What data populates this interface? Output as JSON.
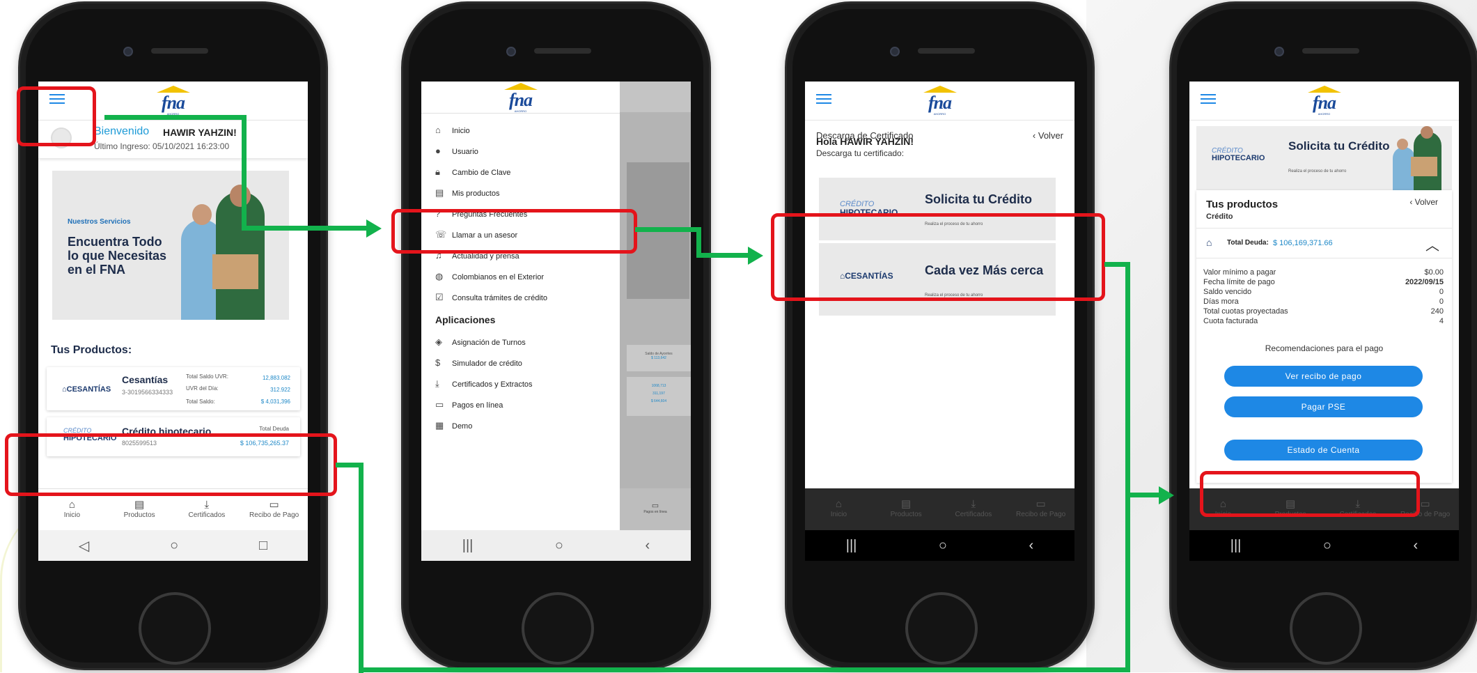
{
  "brand": {
    "logo_text": "fna",
    "logo_sub": "AHORRO"
  },
  "screen1": {
    "welcome_prefix": "Bienvenido",
    "user_name": "HAWIR YAHZIN!",
    "last_login": "Último Ingreso: 05/10/2021 16:23:00",
    "banner_small": "Nuestros Servicios",
    "banner_big": "Encuentra Todo lo que Necesitas en el FNA",
    "products_title": "Tus Productos:",
    "cesantias": {
      "brand": "CESANTÍAS",
      "name": "Cesantías",
      "id": "3-3019566334333",
      "rows": [
        {
          "label": "Total Saldo UVR:",
          "value": "12,883.082"
        },
        {
          "label": "UVR del Día:",
          "value": "312.922"
        },
        {
          "label": "Total Saldo:",
          "value": "$ 4,031,396"
        }
      ]
    },
    "credito": {
      "brand_top": "CRÉDITO",
      "brand": "HIPOTECARIO",
      "name": "Crédito hipotecario",
      "id": "8025599513",
      "label": "Total Deuda",
      "value": "$ 106,735,265.37"
    }
  },
  "bottom_nav": [
    {
      "icon": "home-icon",
      "label": "Inicio"
    },
    {
      "icon": "document-icon",
      "label": "Productos"
    },
    {
      "icon": "download-icon",
      "label": "Certificados"
    },
    {
      "icon": "wallet-icon",
      "label": "Recibo de Pago"
    }
  ],
  "screen2": {
    "menu": [
      {
        "icon": "home-icon",
        "label": "Inicio"
      },
      {
        "icon": "user-icon",
        "label": "Usuario"
      },
      {
        "icon": "lock-icon",
        "label": "Cambio de Clave"
      },
      {
        "icon": "document-icon",
        "label": "Mis productos"
      },
      {
        "icon": "question-icon",
        "label": "Preguntas Frecuentes"
      },
      {
        "icon": "phone-icon",
        "label": "Llamar a un asesor"
      },
      {
        "icon": "bell-icon",
        "label": "Actualidad y prensa"
      },
      {
        "icon": "globe-icon",
        "label": "Colombianos en el Exterior"
      },
      {
        "icon": "clipboard-icon",
        "label": "Consulta trámites de crédito"
      }
    ],
    "section": "Aplicaciones",
    "apps": [
      {
        "icon": "ticket-icon",
        "label": "Asignación de Turnos"
      },
      {
        "icon": "dollar-icon",
        "label": "Simulador de crédito"
      },
      {
        "icon": "download-icon",
        "label": "Certificados y Extractos"
      },
      {
        "icon": "card-icon",
        "label": "Pagos en línea"
      },
      {
        "icon": "building-icon",
        "label": "Demo"
      }
    ],
    "overlay_text": {
      "label1": "Saldo de Ayorrtes",
      "value1": "$ 113,642",
      "v2": "1068,713",
      "v3": "311,197",
      "v4": "$ 644,604",
      "nav": "Pagos en línea"
    }
  },
  "screen3": {
    "title": "Descarga de Certificado",
    "back": "‹ Volver",
    "hello": "Hola HAWIR YAHZIN!",
    "subtitle": "Descarga tu certificado:",
    "card1": {
      "brand_top": "CRÉDITO",
      "brand": "HIPOTECARIO",
      "title": "Solicita tu Crédito",
      "sub": "Realiza el proceso de tu ahorro"
    },
    "card2": {
      "brand": "CESANTÍAS",
      "title": "Cada vez Más cerca",
      "sub": "Realiza el proceso de tu ahorro"
    }
  },
  "screen4": {
    "banner": {
      "brand_top": "CRÉDITO",
      "brand": "HIPOTECARIO",
      "title": "Solicita tu Crédito",
      "sub": "Realiza el proceso de tu ahorro"
    },
    "products_title": "Tus productos",
    "product_type": "Crédito",
    "back": "‹ Volver",
    "total_label": "Total Deuda:",
    "total_value": "$ 106,169,371.66",
    "details": [
      {
        "label": "Valor mínimo a pagar",
        "value": "$0.00"
      },
      {
        "label": "Fecha límite de pago",
        "value": "2022/09/15"
      },
      {
        "label": "Saldo vencido",
        "value": "0"
      },
      {
        "label": "Días mora",
        "value": "0"
      },
      {
        "label": "Total cuotas proyectadas",
        "value": "240"
      },
      {
        "label": "Cuota facturada",
        "value": "4"
      }
    ],
    "reco": "Recomendaciones para el pago",
    "btn1": "Ver recibo de pago",
    "btn2": "Pagar PSE",
    "btn3": "Estado de Cuenta"
  },
  "colors": {
    "accent_blue": "#1e88e5",
    "highlight_red": "#e4141b",
    "flow_green": "#12b24c",
    "brand_navy": "#1a4a9a"
  }
}
